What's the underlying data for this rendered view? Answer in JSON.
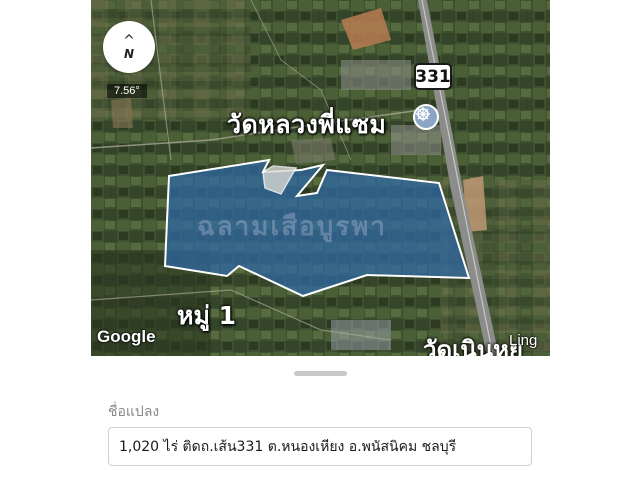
{
  "map": {
    "compass": {
      "arrow": "^",
      "letter": "N"
    },
    "bearing": "7.56°",
    "road_number": "331",
    "poi_label": "วัดหลวงพี่แซม",
    "poi_icon": "temple-wheel-icon",
    "plot_watermark": "ฉลามเสือบูรพา",
    "village_label": "หมู่ 1",
    "cutoff_label": "วัดเนินหย",
    "ling_label": "Ling",
    "google_logo": "Google",
    "colors": {
      "parcel_fill": "#2f6aa8",
      "parcel_border": "#ffffff",
      "satellite_dark": "#2f3d26"
    }
  },
  "sheet": {
    "field_label": "ชื่อแปลง",
    "field_value": "1,020 ไร่ ติดถ.เส้น331 ต.หนองเหียง อ.พนัสนิคม ชลบุรี",
    "field_placeholder": ""
  }
}
